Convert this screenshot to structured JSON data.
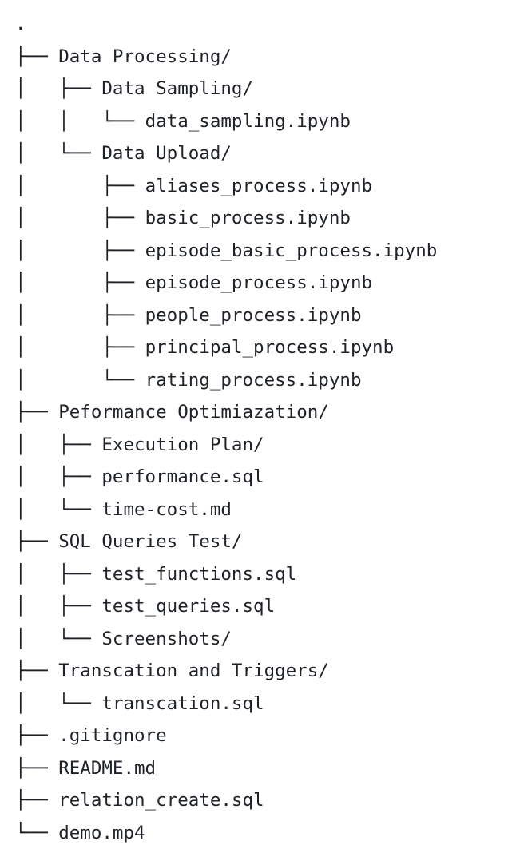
{
  "lines": [
    {
      "guide": "",
      "name": "."
    },
    {
      "guide": "├── ",
      "name": "Data Processing/"
    },
    {
      "guide": "│   ├── ",
      "name": "Data Sampling/"
    },
    {
      "guide": "│   │   └── ",
      "name": "data_sampling.ipynb"
    },
    {
      "guide": "│   └── ",
      "name": "Data Upload/"
    },
    {
      "guide": "│       ├── ",
      "name": "aliases_process.ipynb"
    },
    {
      "guide": "│       ├── ",
      "name": "basic_process.ipynb"
    },
    {
      "guide": "│       ├── ",
      "name": "episode_basic_process.ipynb"
    },
    {
      "guide": "│       ├── ",
      "name": "episode_process.ipynb"
    },
    {
      "guide": "│       ├── ",
      "name": "people_process.ipynb"
    },
    {
      "guide": "│       ├── ",
      "name": "principal_process.ipynb"
    },
    {
      "guide": "│       └── ",
      "name": "rating_process.ipynb"
    },
    {
      "guide": "├── ",
      "name": "Peformance Optimiazation/"
    },
    {
      "guide": "│   ├── ",
      "name": "Execution Plan/"
    },
    {
      "guide": "│   ├── ",
      "name": "performance.sql"
    },
    {
      "guide": "│   └── ",
      "name": "time-cost.md"
    },
    {
      "guide": "├── ",
      "name": "SQL Queries Test/"
    },
    {
      "guide": "│   ├── ",
      "name": "test_functions.sql"
    },
    {
      "guide": "│   ├── ",
      "name": "test_queries.sql"
    },
    {
      "guide": "│   └── ",
      "name": "Screenshots/"
    },
    {
      "guide": "├── ",
      "name": "Transcation and Triggers/"
    },
    {
      "guide": "│   └── ",
      "name": "transcation.sql"
    },
    {
      "guide": "├── ",
      "name": ".gitignore"
    },
    {
      "guide": "├── ",
      "name": "README.md"
    },
    {
      "guide": "├── ",
      "name": "relation_create.sql"
    },
    {
      "guide": "└── ",
      "name": "demo.mp4"
    }
  ]
}
